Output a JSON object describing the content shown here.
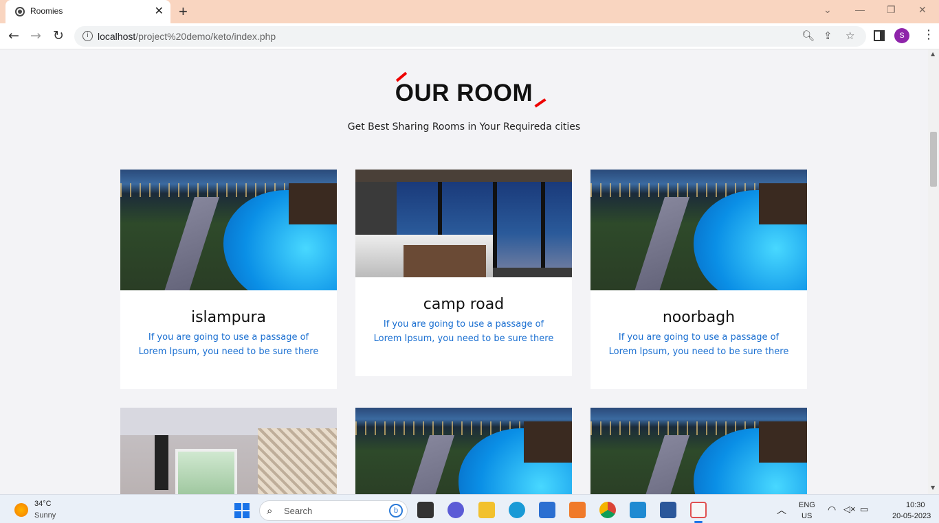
{
  "browser": {
    "tab_title": "Roomies",
    "tab_close": "✕",
    "new_tab": "+",
    "url_host": "localhost",
    "url_path": "/project%20demo/keto/index.php",
    "profile_initial": "S"
  },
  "window_controls": {
    "chevron": "⌄",
    "minimize": "—",
    "restore": "❐",
    "close": "✕"
  },
  "page": {
    "heading": "OUR ROOM",
    "subheading": "Get Best Sharing Rooms in Your Requireda cities",
    "accent_color": "#e00000",
    "rooms": [
      {
        "name": "islampura",
        "description": "If you are going to use a passage of Lorem Ipsum, you need to be sure there",
        "image": "resort-pool"
      },
      {
        "name": "camp road",
        "description": "If you are going to use a passage of Lorem Ipsum, you need to be sure there",
        "image": "city-view-bedroom"
      },
      {
        "name": "noorbagh",
        "description": "If you are going to use a passage of Lorem Ipsum, you need to be sure there",
        "image": "resort-pool"
      },
      {
        "image": "modern-bedroom"
      },
      {
        "image": "resort-pool"
      },
      {
        "image": "resort-pool"
      }
    ]
  },
  "taskbar": {
    "weather_temp": "34°C",
    "weather_cond": "Sunny",
    "search_label": "Search",
    "lang": "ENG",
    "region": "US",
    "time": "10:30",
    "date": "20-05-2023"
  }
}
